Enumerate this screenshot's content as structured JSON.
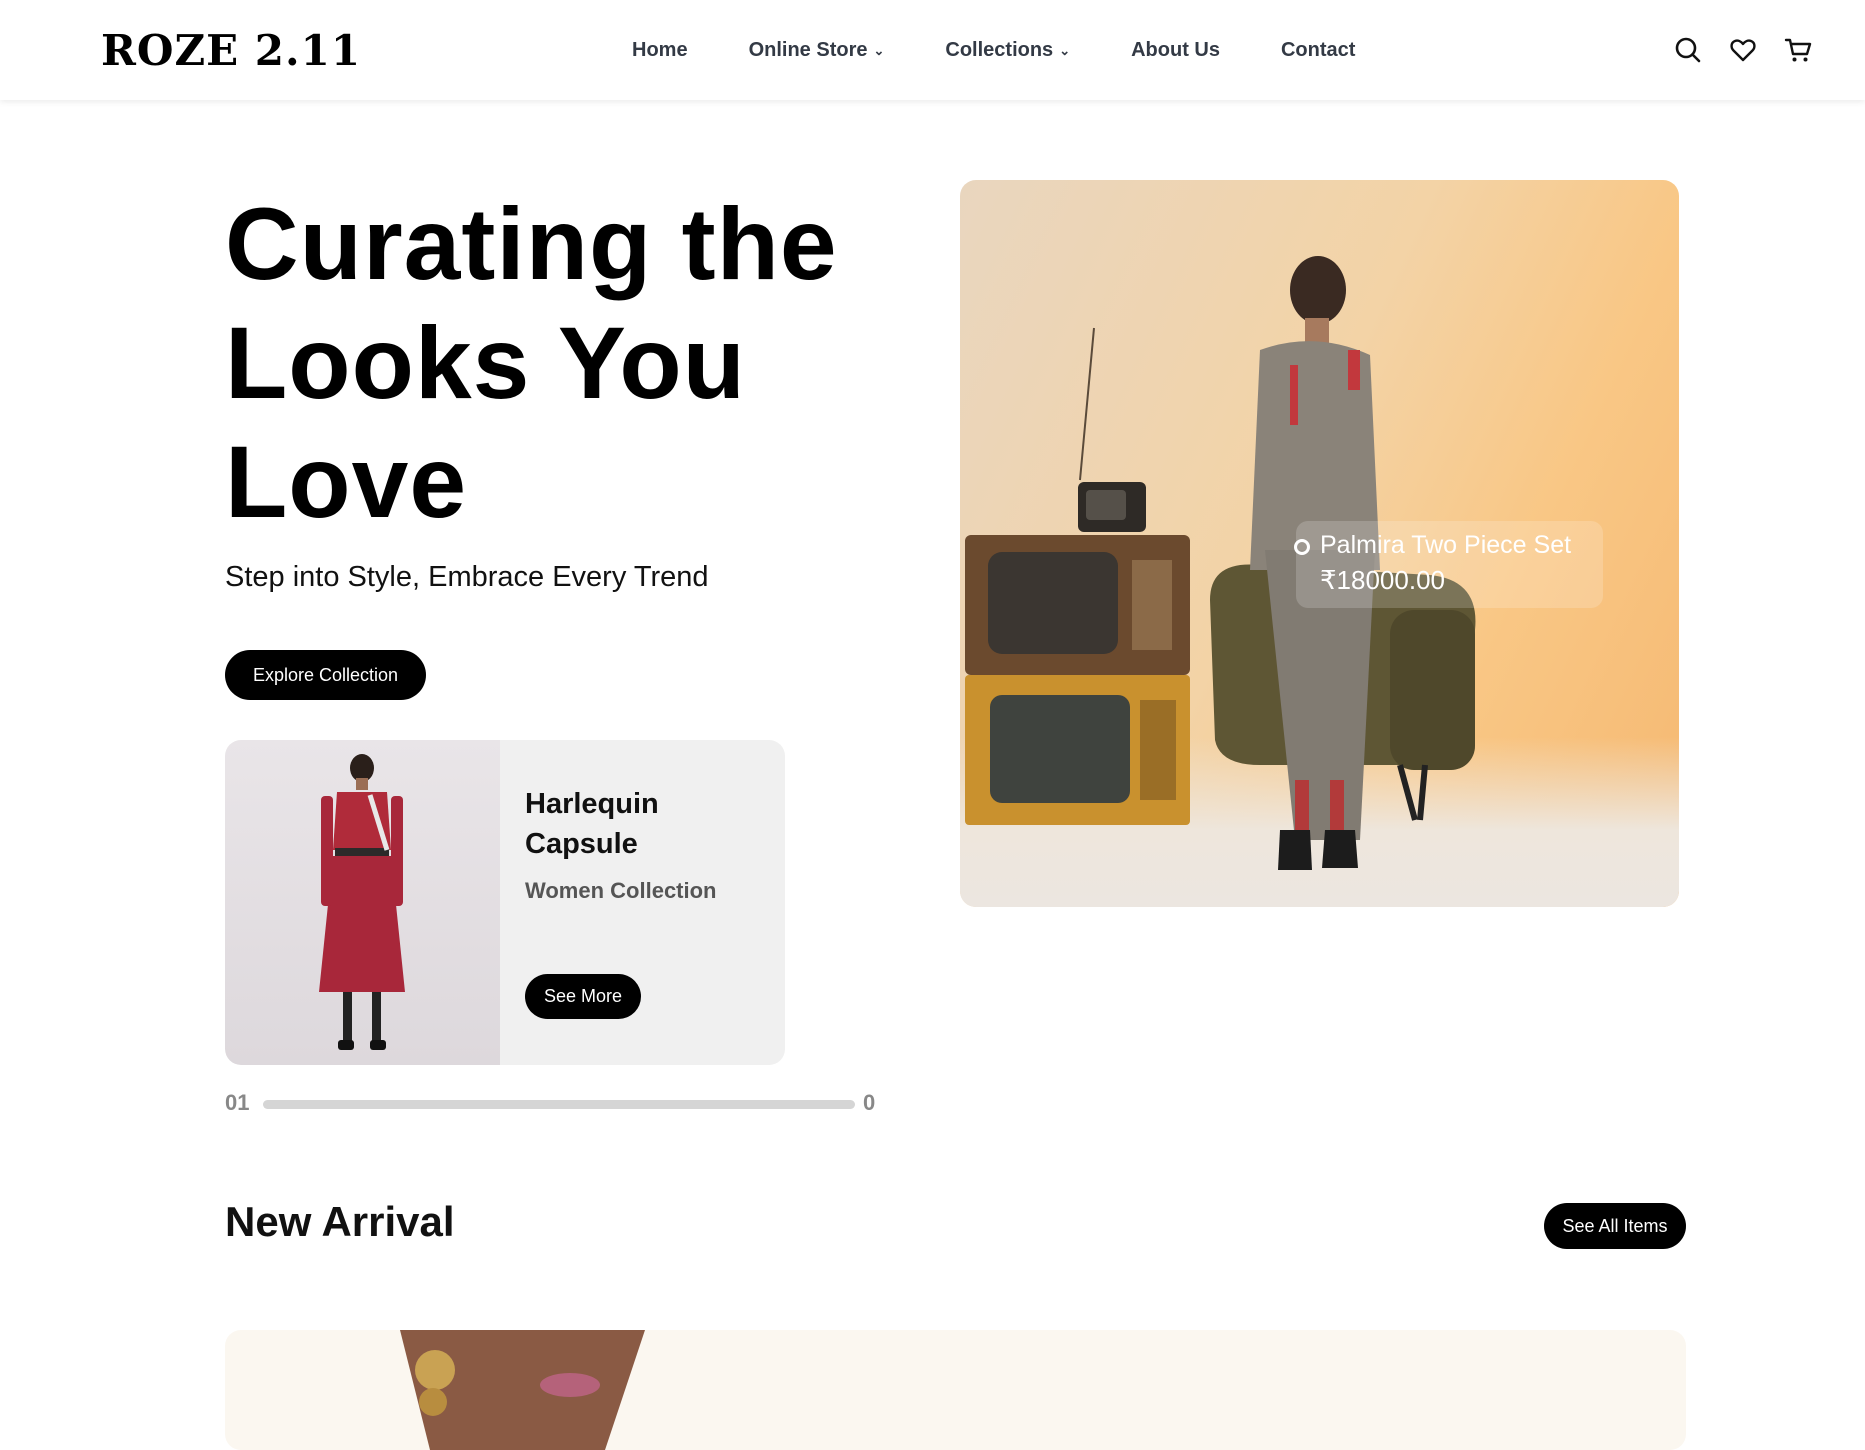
{
  "brand": {
    "logo_text": "ROZE 2.11"
  },
  "nav": {
    "items": [
      {
        "label": "Home",
        "dropdown": false
      },
      {
        "label": "Online Store",
        "dropdown": true
      },
      {
        "label": "Collections",
        "dropdown": true
      },
      {
        "label": "About Us",
        "dropdown": false
      },
      {
        "label": "Contact",
        "dropdown": false
      }
    ],
    "icons": [
      "search-icon",
      "heart-icon",
      "cart-icon"
    ]
  },
  "hero": {
    "title": "Curating the Looks You Love",
    "subtitle": "Step into Style, Embrace Every Trend",
    "cta_label": "Explore Collection",
    "featured_product": {
      "name": "Palmira Two Piece Set",
      "price": "₹18000.00"
    }
  },
  "collection_card": {
    "title": "Harlequin Capsule",
    "subtitle": "Women Collection",
    "button_label": "See More"
  },
  "slider": {
    "current": "01",
    "total": "0"
  },
  "new_arrival": {
    "title": "New Arrival",
    "button_label": "See All Items"
  },
  "colors": {
    "accent": "#000000",
    "nav_text": "#333a45",
    "card_bg": "#f0f0f0",
    "hero_bg": "#f3d3a6"
  }
}
